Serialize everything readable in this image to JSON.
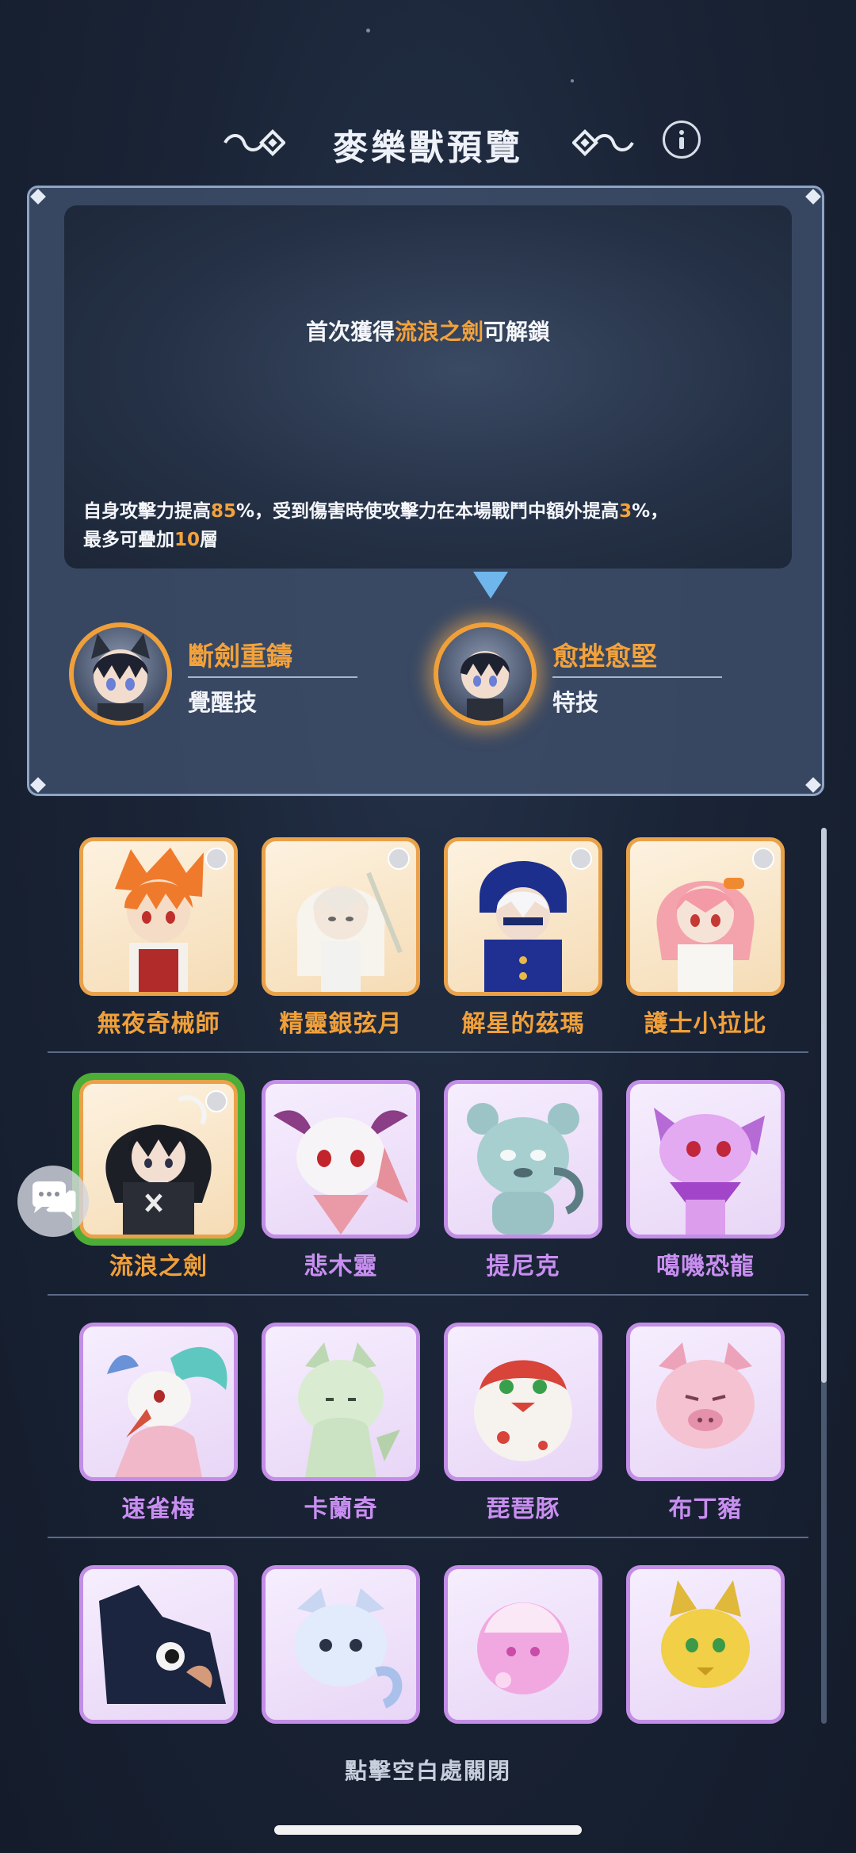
{
  "header": {
    "title": "麥樂獸預覽",
    "info_icon": "info-icon"
  },
  "preview": {
    "unlock_prefix": "首次獲得",
    "unlock_name": "流浪之劍",
    "unlock_suffix": "可解鎖",
    "desc": {
      "p1": "自身攻擊力提高",
      "v1": "85",
      "p2": "%，受到傷害時使攻擊力在本場戰鬥中額外提高",
      "v2": "3",
      "p3": "%，",
      "p4": "最多可疊加",
      "v3": "10",
      "p5": "層"
    },
    "skills": [
      {
        "name": "斷劍重鑄",
        "type": "覺醒技"
      },
      {
        "name": "愈挫愈堅",
        "type": "特技"
      }
    ]
  },
  "grid": {
    "rows": [
      [
        {
          "name": "無夜奇械師",
          "rarity": "orange",
          "badge": true
        },
        {
          "name": "精靈銀弦月",
          "rarity": "orange",
          "badge": true
        },
        {
          "name": "解星的茲瑪",
          "rarity": "orange",
          "badge": true
        },
        {
          "name": "護士小拉比",
          "rarity": "orange",
          "badge": true
        }
      ],
      [
        {
          "name": "流浪之劍",
          "rarity": "orange",
          "badge": true,
          "selected": true
        },
        {
          "name": "悲木靈",
          "rarity": "purple"
        },
        {
          "name": "提尼克",
          "rarity": "purple"
        },
        {
          "name": "噶嘰恐龍",
          "rarity": "purple"
        }
      ],
      [
        {
          "name": "速雀梅",
          "rarity": "purple"
        },
        {
          "name": "卡蘭奇",
          "rarity": "purple"
        },
        {
          "name": "琵琶豚",
          "rarity": "purple"
        },
        {
          "name": "布丁豬",
          "rarity": "purple"
        }
      ],
      [
        {
          "name": "",
          "rarity": "purple"
        },
        {
          "name": "",
          "rarity": "purple"
        },
        {
          "name": "",
          "rarity": "purple"
        },
        {
          "name": "",
          "rarity": "purple"
        }
      ]
    ]
  },
  "footer": {
    "close_hint": "點擊空白處關閉"
  },
  "colors": {
    "accent_orange": "#f3a23b",
    "rarity_purple": "#c88ef0",
    "selected_green": "#4cae36"
  }
}
